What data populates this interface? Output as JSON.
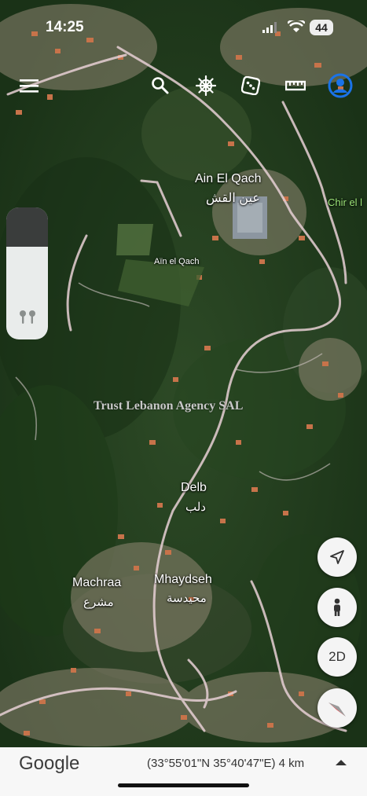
{
  "status_bar": {
    "time": "14:25",
    "battery": "44"
  },
  "places": [
    {
      "id": "ain-el-qach",
      "latin": "Ain El Qach",
      "arabic": "عين القش"
    },
    {
      "id": "ain-el-qach-small",
      "latin": "Aïn el Qach"
    },
    {
      "id": "chir-el",
      "latin": "Chir el l"
    },
    {
      "id": "delb",
      "latin": "Delb",
      "arabic": "دلب"
    },
    {
      "id": "machraa",
      "latin": "Machraa",
      "arabic": "مشرع"
    },
    {
      "id": "mhaydseh",
      "latin": "Mhaydseh",
      "arabic": "محيدسة"
    }
  ],
  "watermark": "Trust Lebanon Agency SAL",
  "bottom_bar": {
    "logo": "Google",
    "coordinates": "(33°55'01\"N 35°40'47\"E) 4 km"
  },
  "fab": {
    "view_mode": "2D"
  },
  "colors": {
    "road": "#e7d0d5",
    "label_green": "#9fe87a",
    "compass_red": "#e0242a",
    "user_blue": "#1a73e8"
  },
  "icons": [
    "menu-icon",
    "search-icon",
    "ship-wheel-icon",
    "dice-icon",
    "ruler-icon",
    "account-icon",
    "location-arrow-icon",
    "pegman-icon",
    "compass-icon",
    "chevron-up-icon",
    "earbuds-icon"
  ]
}
